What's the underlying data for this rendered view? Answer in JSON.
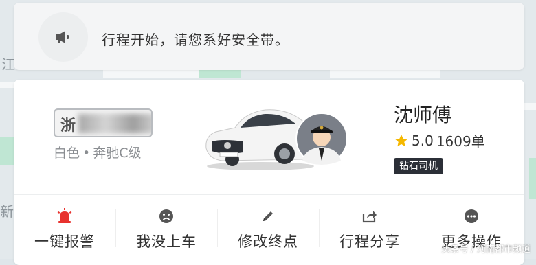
{
  "notice": {
    "message": "行程开始，请您系好安全带。",
    "icon": "megaphone-icon"
  },
  "map": {
    "labels": [
      "江",
      "新纟"
    ]
  },
  "driver": {
    "plate": "浙",
    "car_color": "白色",
    "car_model": "奔驰C级",
    "name": "沈师傅",
    "rating": "5.0",
    "orders": "1609单",
    "badge": "钻石司机"
  },
  "actions": [
    {
      "label": "一键报警",
      "icon": "alarm-icon"
    },
    {
      "label": "我没上车",
      "icon": "sad-face-icon"
    },
    {
      "label": "修改终点",
      "icon": "pencil-icon"
    },
    {
      "label": "行程分享",
      "icon": "share-icon"
    },
    {
      "label": "更多操作",
      "icon": "more-icon"
    }
  ],
  "watermark": {
    "text": "头条号 / 河南都市频道"
  },
  "colors": {
    "alarm": "#e8322e",
    "star": "#f5b800",
    "badge_bg": "#2b2f37"
  }
}
